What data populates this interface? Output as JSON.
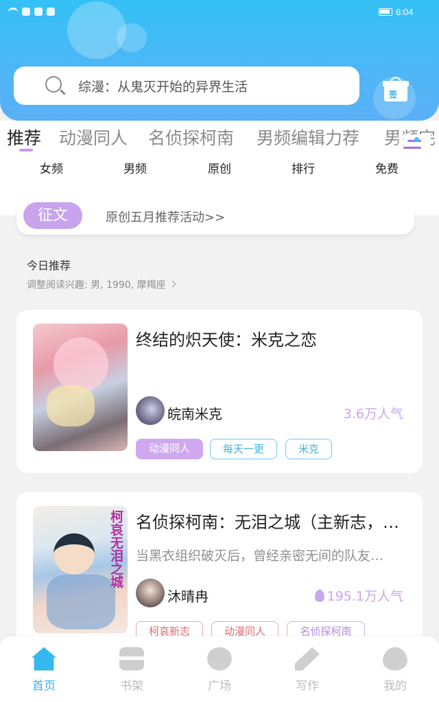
{
  "status_bar": {
    "time": "6:04"
  },
  "search": {
    "placeholder": "综漫：从鬼灭开始的异界生活"
  },
  "gift": {
    "label": "签"
  },
  "tabs": [
    {
      "label": "推荐",
      "active": true
    },
    {
      "label": "动漫同人",
      "active": false
    },
    {
      "label": "名侦探柯南",
      "active": false
    },
    {
      "label": "男频编辑力荐",
      "active": false
    },
    {
      "label": "男频完",
      "active": false
    }
  ],
  "subnav": [
    "女频",
    "男频",
    "原创",
    "排行",
    "免费"
  ],
  "banner": {
    "badge": "征文",
    "text": "原创五月推荐活动>>"
  },
  "today": {
    "title": "今日推荐",
    "interest": "调整阅读兴趣: 男, 1990, 摩羯座"
  },
  "books": [
    {
      "title": "终结的炽天使：米克之恋",
      "description": "",
      "author": "皖南米克",
      "popularity": "3.6万人气",
      "tags": [
        "动漫同人",
        "每天一更",
        "米克"
      ]
    },
    {
      "title": "名侦探柯南：无泪之城（主新志，…",
      "description": "当黑衣组织破灭后，曾经亲密无间的队友…",
      "author": "沐晴冉",
      "popularity": "195.1万人气",
      "tags": [
        "柯哀新志",
        "动漫同人",
        "名侦探柯南"
      ],
      "cover_text": "柯哀无泪之城"
    }
  ],
  "bottom_nav": [
    {
      "label": "首页",
      "icon": "home-icon",
      "active": true
    },
    {
      "label": "书架",
      "icon": "bookshelf-icon",
      "active": false
    },
    {
      "label": "广场",
      "icon": "plaza-icon",
      "active": false
    },
    {
      "label": "写作",
      "icon": "write-icon",
      "active": false
    },
    {
      "label": "我的",
      "icon": "mine-icon",
      "active": false
    }
  ],
  "colors": {
    "header": "#34c1f5",
    "accent": "#c9a3ee",
    "active_nav": "#2fb4ef"
  }
}
